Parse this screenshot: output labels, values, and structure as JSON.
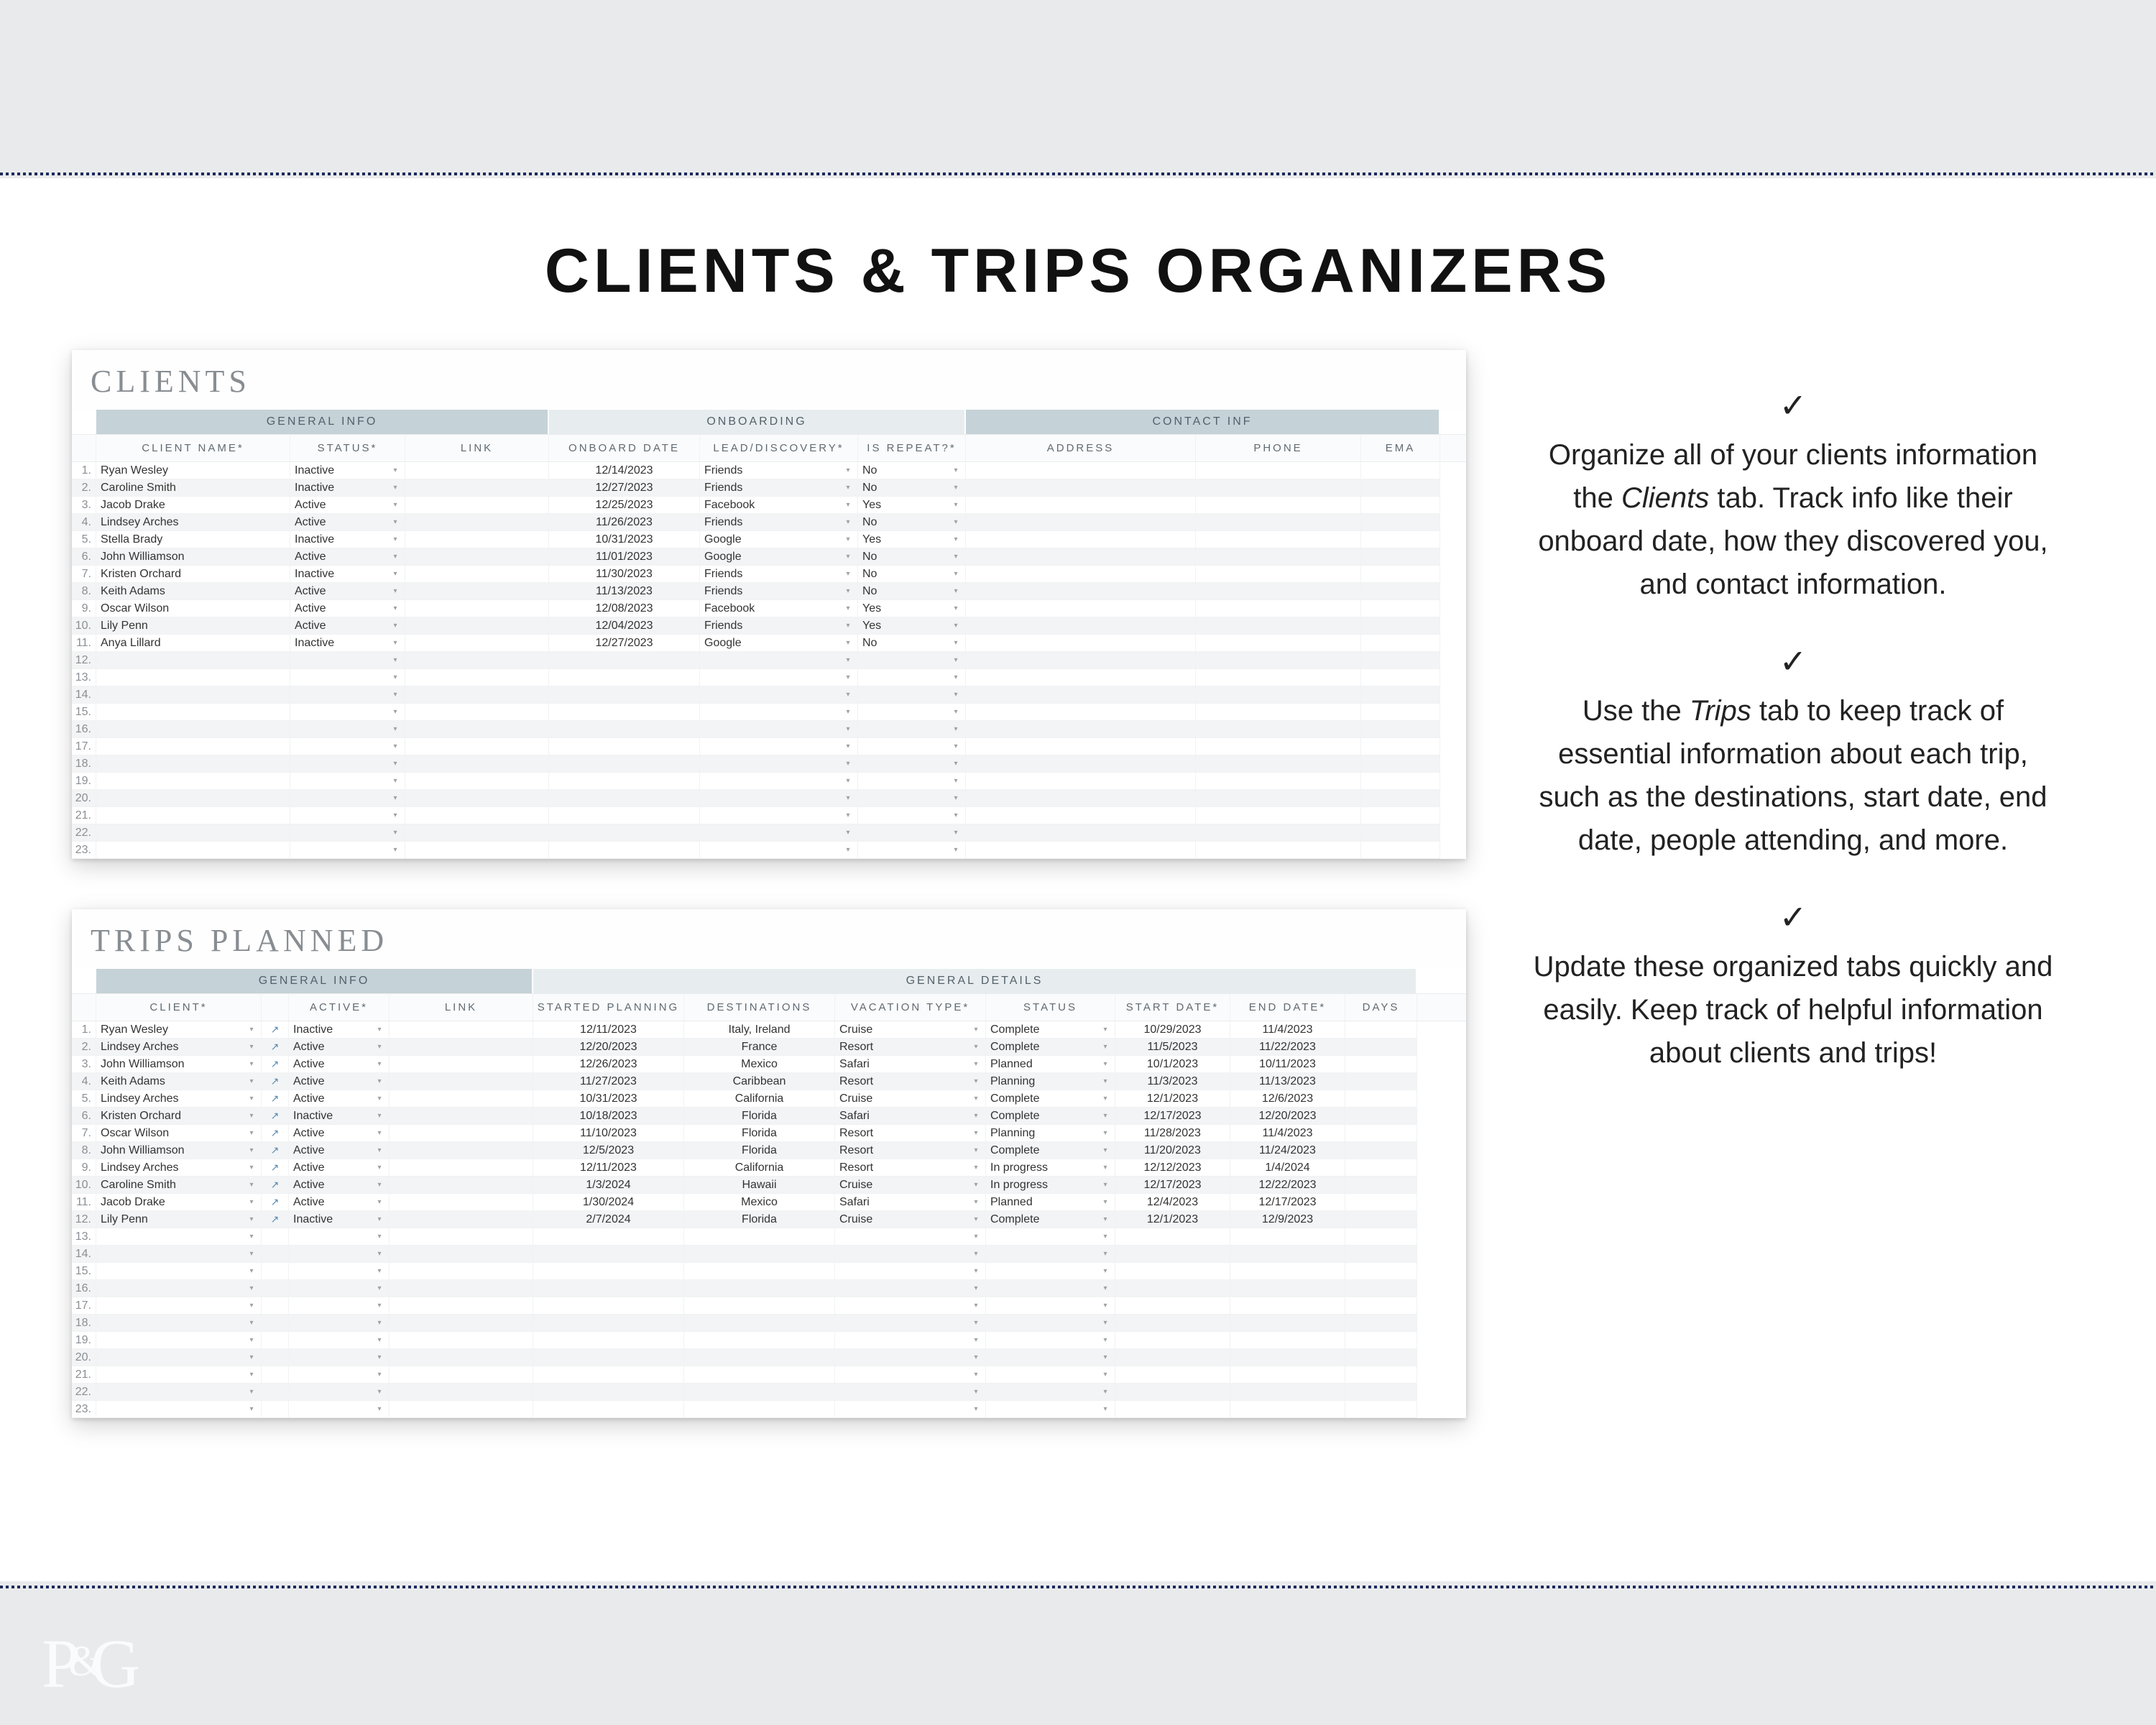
{
  "page_title": "CLIENTS & TRIPS ORGANIZERS",
  "logo": "P&G",
  "clients_sheet": {
    "title": "CLIENTS",
    "bands": [
      {
        "label": "GENERAL INFO",
        "span": 3,
        "light": false
      },
      {
        "label": "ONBOARDING",
        "span": 3,
        "light": true
      },
      {
        "label": "CONTACT INF",
        "span": 3,
        "light": false
      }
    ],
    "headers": [
      "CLIENT NAME*",
      "STATUS*",
      "LINK",
      "ONBOARD DATE",
      "LEAD/DISCOVERY*",
      "IS REPEAT?*",
      "ADDRESS",
      "PHONE",
      "EMA"
    ],
    "rows": [
      {
        "n": "1.",
        "name": "Ryan Wesley",
        "status": "Inactive",
        "ob": "12/14/2023",
        "lead": "Friends",
        "rep": "No"
      },
      {
        "n": "2.",
        "name": "Caroline Smith",
        "status": "Inactive",
        "ob": "12/27/2023",
        "lead": "Friends",
        "rep": "No"
      },
      {
        "n": "3.",
        "name": "Jacob Drake",
        "status": "Active",
        "ob": "12/25/2023",
        "lead": "Facebook",
        "rep": "Yes"
      },
      {
        "n": "4.",
        "name": "Lindsey Arches",
        "status": "Active",
        "ob": "11/26/2023",
        "lead": "Friends",
        "rep": "No"
      },
      {
        "n": "5.",
        "name": "Stella Brady",
        "status": "Inactive",
        "ob": "10/31/2023",
        "lead": "Google",
        "rep": "Yes"
      },
      {
        "n": "6.",
        "name": "John Williamson",
        "status": "Active",
        "ob": "11/01/2023",
        "lead": "Google",
        "rep": "No"
      },
      {
        "n": "7.",
        "name": "Kristen Orchard",
        "status": "Inactive",
        "ob": "11/30/2023",
        "lead": "Friends",
        "rep": "No"
      },
      {
        "n": "8.",
        "name": "Keith Adams",
        "status": "Active",
        "ob": "11/13/2023",
        "lead": "Friends",
        "rep": "No"
      },
      {
        "n": "9.",
        "name": "Oscar Wilson",
        "status": "Active",
        "ob": "12/08/2023",
        "lead": "Facebook",
        "rep": "Yes"
      },
      {
        "n": "10.",
        "name": "Lily Penn",
        "status": "Active",
        "ob": "12/04/2023",
        "lead": "Friends",
        "rep": "Yes"
      },
      {
        "n": "11.",
        "name": "Anya Lillard",
        "status": "Inactive",
        "ob": "12/27/2023",
        "lead": "Google",
        "rep": "No"
      },
      {
        "n": "12."
      },
      {
        "n": "13."
      },
      {
        "n": "14."
      },
      {
        "n": "15."
      },
      {
        "n": "16."
      },
      {
        "n": "17."
      },
      {
        "n": "18."
      },
      {
        "n": "19."
      },
      {
        "n": "20."
      },
      {
        "n": "21."
      },
      {
        "n": "22."
      },
      {
        "n": "23."
      }
    ]
  },
  "trips_sheet": {
    "title": "TRIPS PLANNED",
    "bands": [
      {
        "label": "GENERAL INFO",
        "span": 4,
        "light": false
      },
      {
        "label": "GENERAL DETAILS",
        "span": 7,
        "light": true
      }
    ],
    "headers": [
      "CLIENT*",
      "",
      "ACTIVE*",
      "LINK",
      "STARTED PLANNING",
      "DESTINATIONS",
      "VACATION TYPE*",
      "STATUS",
      "START DATE*",
      "END DATE*",
      "DAYS"
    ],
    "rows": [
      {
        "n": "1.",
        "client": "Ryan Wesley",
        "active": "Inactive",
        "sp": "12/11/2023",
        "dest": "Italy, Ireland",
        "vt": "Cruise",
        "status": "Complete",
        "sd": "10/29/2023",
        "ed": "11/4/2023"
      },
      {
        "n": "2.",
        "client": "Lindsey Arches",
        "active": "Active",
        "sp": "12/20/2023",
        "dest": "France",
        "vt": "Resort",
        "status": "Complete",
        "sd": "11/5/2023",
        "ed": "11/22/2023"
      },
      {
        "n": "3.",
        "client": "John Williamson",
        "active": "Active",
        "sp": "12/26/2023",
        "dest": "Mexico",
        "vt": "Safari",
        "status": "Planned",
        "sd": "10/1/2023",
        "ed": "10/11/2023"
      },
      {
        "n": "4.",
        "client": "Keith Adams",
        "active": "Active",
        "sp": "11/27/2023",
        "dest": "Caribbean",
        "vt": "Resort",
        "status": "Planning",
        "sd": "11/3/2023",
        "ed": "11/13/2023"
      },
      {
        "n": "5.",
        "client": "Lindsey Arches",
        "active": "Active",
        "sp": "10/31/2023",
        "dest": "California",
        "vt": "Cruise",
        "status": "Complete",
        "sd": "12/1/2023",
        "ed": "12/6/2023"
      },
      {
        "n": "6.",
        "client": "Kristen Orchard",
        "active": "Inactive",
        "sp": "10/18/2023",
        "dest": "Florida",
        "vt": "Safari",
        "status": "Complete",
        "sd": "12/17/2023",
        "ed": "12/20/2023"
      },
      {
        "n": "7.",
        "client": "Oscar Wilson",
        "active": "Active",
        "sp": "11/10/2023",
        "dest": "Florida",
        "vt": "Resort",
        "status": "Planning",
        "sd": "11/28/2023",
        "ed": "11/4/2023"
      },
      {
        "n": "8.",
        "client": "John Williamson",
        "active": "Active",
        "sp": "12/5/2023",
        "dest": "Florida",
        "vt": "Resort",
        "status": "Complete",
        "sd": "11/20/2023",
        "ed": "11/24/2023"
      },
      {
        "n": "9.",
        "client": "Lindsey Arches",
        "active": "Active",
        "sp": "12/11/2023",
        "dest": "California",
        "vt": "Resort",
        "status": "In progress",
        "sd": "12/12/2023",
        "ed": "1/4/2024"
      },
      {
        "n": "10.",
        "client": "Caroline Smith",
        "active": "Active",
        "sp": "1/3/2024",
        "dest": "Hawaii",
        "vt": "Cruise",
        "status": "In progress",
        "sd": "12/17/2023",
        "ed": "12/22/2023"
      },
      {
        "n": "11.",
        "client": "Jacob Drake",
        "active": "Active",
        "sp": "1/30/2024",
        "dest": "Mexico",
        "vt": "Safari",
        "status": "Planned",
        "sd": "12/4/2023",
        "ed": "12/17/2023"
      },
      {
        "n": "12.",
        "client": "Lily Penn",
        "active": "Inactive",
        "sp": "2/7/2024",
        "dest": "Florida",
        "vt": "Cruise",
        "status": "Complete",
        "sd": "12/1/2023",
        "ed": "12/9/2023"
      },
      {
        "n": "13."
      },
      {
        "n": "14."
      },
      {
        "n": "15."
      },
      {
        "n": "16."
      },
      {
        "n": "17."
      },
      {
        "n": "18."
      },
      {
        "n": "19."
      },
      {
        "n": "20."
      },
      {
        "n": "21."
      },
      {
        "n": "22."
      },
      {
        "n": "23."
      }
    ]
  },
  "blurbs": [
    "Organize all of your clients information the <em>Clients</em> tab. Track info like their onboard date, how they discovered you, and contact information.",
    "Use the <em>Trips</em> tab to keep track of essential information about each trip, such as the destinations, start date, end date, people attending, and more.",
    "Update these organized tabs quickly and easily. Keep track of helpful information about clients and trips!"
  ],
  "check": "✓",
  "dd": "▾",
  "link_icon": "↗"
}
